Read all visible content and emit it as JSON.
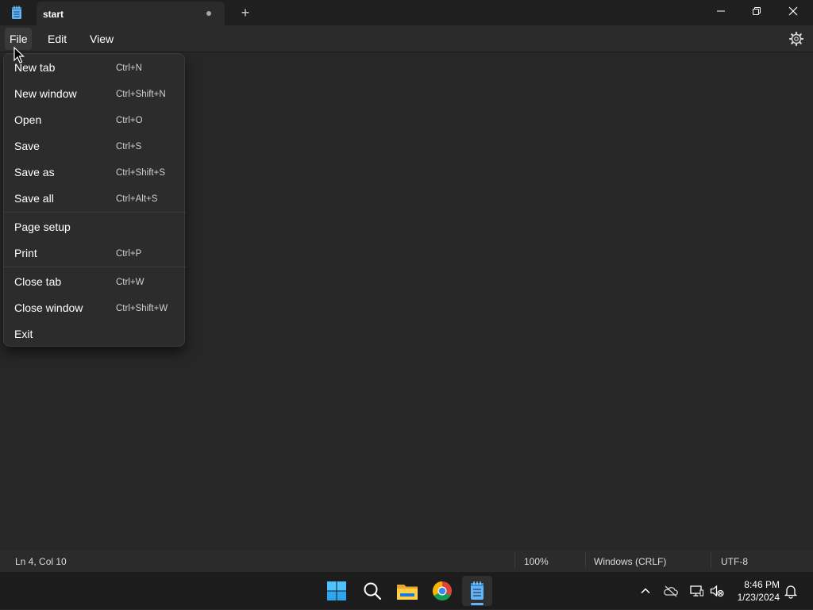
{
  "window": {
    "tab_title": "start",
    "new_tab_symbol": "+"
  },
  "menubar": {
    "file": "File",
    "edit": "Edit",
    "view": "View"
  },
  "file_menu": {
    "items": [
      {
        "label": "New tab",
        "shortcut": "Ctrl+N"
      },
      {
        "label": "New window",
        "shortcut": "Ctrl+Shift+N"
      },
      {
        "label": "Open",
        "shortcut": "Ctrl+O"
      },
      {
        "label": "Save",
        "shortcut": "Ctrl+S"
      },
      {
        "label": "Save as",
        "shortcut": "Ctrl+Shift+S"
      },
      {
        "label": "Save all",
        "shortcut": "Ctrl+Alt+S"
      },
      {
        "label": "Page setup",
        "shortcut": ""
      },
      {
        "label": "Print",
        "shortcut": "Ctrl+P"
      },
      {
        "label": "Close tab",
        "shortcut": "Ctrl+W"
      },
      {
        "label": "Close window",
        "shortcut": "Ctrl+Shift+W"
      },
      {
        "label": "Exit",
        "shortcut": ""
      }
    ]
  },
  "statusbar": {
    "position": "Ln 4, Col 10",
    "zoom": "100%",
    "line_ending": "Windows (CRLF)",
    "encoding": "UTF-8"
  },
  "taskbar": {
    "time": "8:46 PM",
    "date": "1/23/2024"
  },
  "colors": {
    "background": "#272727",
    "titlebar": "#1f1f1f",
    "menu": "#2c2c2c",
    "accent": "#62b4f7"
  }
}
